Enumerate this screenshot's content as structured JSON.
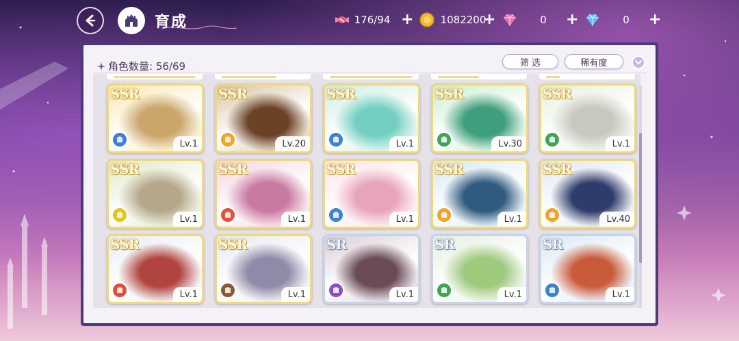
{
  "header": {
    "title": "育成",
    "resources": [
      {
        "name": "candy",
        "value": "176/94",
        "icon": "candy-icon",
        "color": "#e85a8a"
      },
      {
        "name": "coin",
        "value": "1082200",
        "icon": "coin-icon",
        "color": "#f2b933"
      },
      {
        "name": "pink-gem",
        "value": "0",
        "icon": "pink-diamond-icon",
        "color": "#e76fb0"
      },
      {
        "name": "blue-gem",
        "value": "0",
        "icon": "blue-diamond-icon",
        "color": "#5fc1f0"
      }
    ]
  },
  "panel": {
    "count_label": "角色数量: 56/69",
    "filter_label": "筛 选",
    "sort_label": "稀有度"
  },
  "cards": [
    {
      "rarity": "SSR",
      "level": "Lv.1",
      "attr": "yellow-tag",
      "attr_color": "#3d82d6",
      "art": [
        "#fbe8b0",
        "#caa66a"
      ]
    },
    {
      "rarity": "SSR",
      "level": "Lv.20",
      "attr": "yellow-tag",
      "attr_color": "#f2a227",
      "art": [
        "#d7c5a3",
        "#6c4227"
      ]
    },
    {
      "rarity": "SSR",
      "level": "Lv.1",
      "attr": "blue-boot",
      "attr_color": "#3d82d6",
      "art": [
        "#cdeee5",
        "#72cfc0"
      ]
    },
    {
      "rarity": "SSR",
      "level": "Lv.30",
      "attr": "green-tag",
      "attr_color": "#3fa556",
      "art": [
        "#cdeed0",
        "#3f9f7d"
      ]
    },
    {
      "rarity": "SSR",
      "level": "Lv.1",
      "attr": "green-key",
      "attr_color": "#3fa556",
      "art": [
        "#e6efe0",
        "#c8c8c0"
      ]
    },
    {
      "rarity": "SSR",
      "level": "Lv.1",
      "attr": "yellow-tag",
      "attr_color": "#e3c31c",
      "art": [
        "#dfe8c8",
        "#b5a889"
      ]
    },
    {
      "rarity": "SSR",
      "level": "Lv.1",
      "attr": "red-tag",
      "attr_color": "#e0513b",
      "art": [
        "#f4d3df",
        "#c97aa2"
      ]
    },
    {
      "rarity": "SSR",
      "level": "Lv.1",
      "attr": "blue-key",
      "attr_color": "#3d82d6",
      "art": [
        "#fde3ea",
        "#e8a4bd"
      ]
    },
    {
      "rarity": "SSR",
      "level": "Lv.1",
      "attr": "orange-tag",
      "attr_color": "#f2a227",
      "art": [
        "#d6e8f3",
        "#2f5b7f"
      ]
    },
    {
      "rarity": "SSR",
      "level": "Lv.40",
      "attr": "orange-tag",
      "attr_color": "#f2a227",
      "art": [
        "#dfe7f0",
        "#2f3b6a"
      ]
    },
    {
      "rarity": "SSR",
      "level": "Lv.1",
      "attr": "red-tag",
      "attr_color": "#e0513b",
      "art": [
        "#e7eef6",
        "#b2443f"
      ]
    },
    {
      "rarity": "SSR",
      "level": "Lv.1",
      "attr": "brown-shield",
      "attr_color": "#8a5a34",
      "art": [
        "#e6eaf0",
        "#8e8aa8"
      ]
    },
    {
      "rarity": "SR",
      "level": "Lv.1",
      "attr": "purple-boot",
      "attr_color": "#8a4fc7",
      "art": [
        "#d9cfd8",
        "#6b4b55"
      ]
    },
    {
      "rarity": "SR",
      "level": "Lv.1",
      "attr": "green-shield",
      "attr_color": "#3fa556",
      "art": [
        "#e6efe0",
        "#9fc97d"
      ]
    },
    {
      "rarity": "SR",
      "level": "Lv.1",
      "attr": "blue-key",
      "attr_color": "#3d82d6",
      "art": [
        "#dbe9f5",
        "#c95b3b"
      ]
    }
  ]
}
